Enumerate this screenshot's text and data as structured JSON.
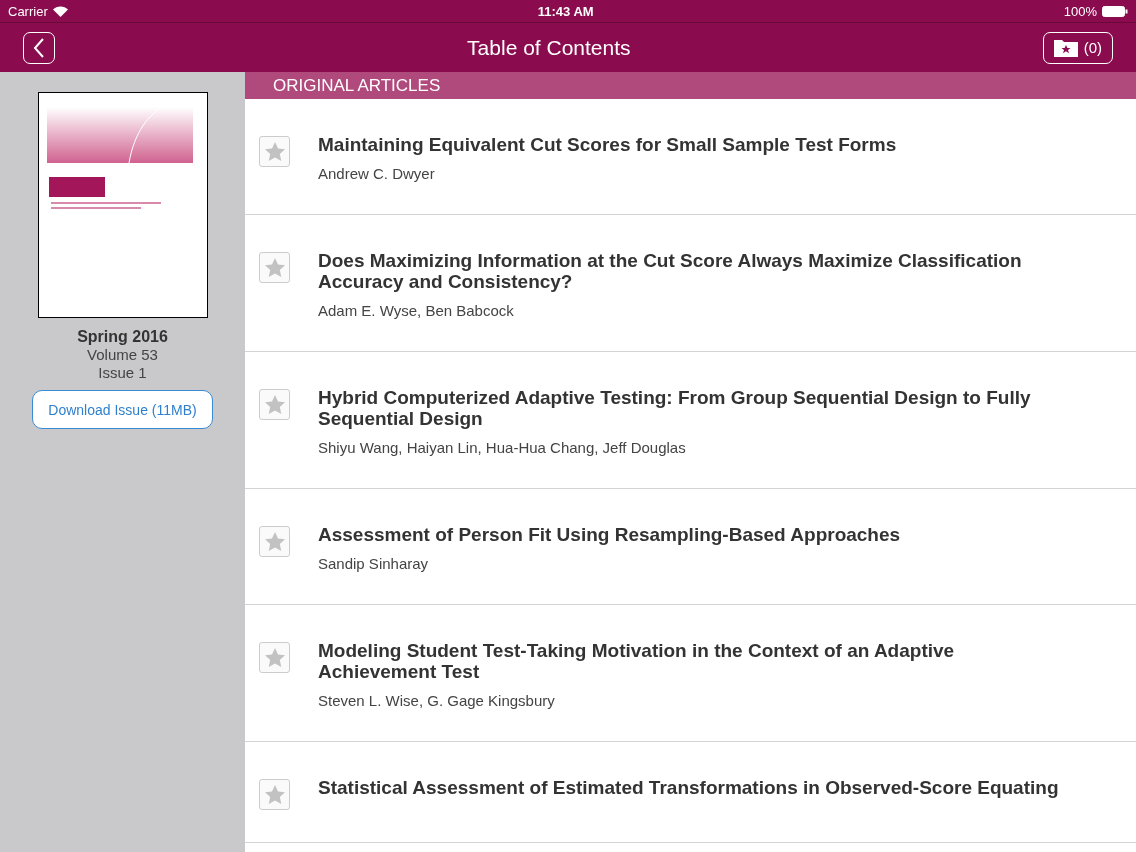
{
  "status_bar": {
    "carrier": "Carrier",
    "time": "11:43 AM",
    "battery": "100%"
  },
  "nav": {
    "title": "Table of Contents",
    "favorites_count": "(0)"
  },
  "issue": {
    "season": "Spring 2016",
    "volume": "Volume 53",
    "issue": "Issue 1",
    "download_button": "Download Issue (11MB)"
  },
  "section": "ORIGINAL ARTICLES",
  "articles": [
    {
      "title": "Maintaining Equivalent Cut Scores for Small Sample Test Forms",
      "authors": "Andrew C. Dwyer",
      "starred": false
    },
    {
      "title": "Does Maximizing Information at the Cut Score Always Maximize Classification Accuracy and Consistency?",
      "authors": "Adam E. Wyse, Ben Babcock",
      "starred": false
    },
    {
      "title": "Hybrid Computerized Adaptive Testing: From Group Sequential Design to Fully Sequential Design",
      "authors": "Shiyu Wang, Haiyan Lin, Hua-Hua Chang, Jeff Douglas",
      "starred": false
    },
    {
      "title": "Assessment of Person Fit Using Resampling-Based Approaches",
      "authors": "Sandip Sinharay",
      "starred": false
    },
    {
      "title": "Modeling Student Test-Taking Motivation in the Context of an Adaptive Achievement Test",
      "authors": "Steven L. Wise, G. Gage Kingsbury",
      "starred": false
    },
    {
      "title": "Statistical Assessment of Estimated Transformations in Observed-Score Equating",
      "starred": false
    }
  ]
}
